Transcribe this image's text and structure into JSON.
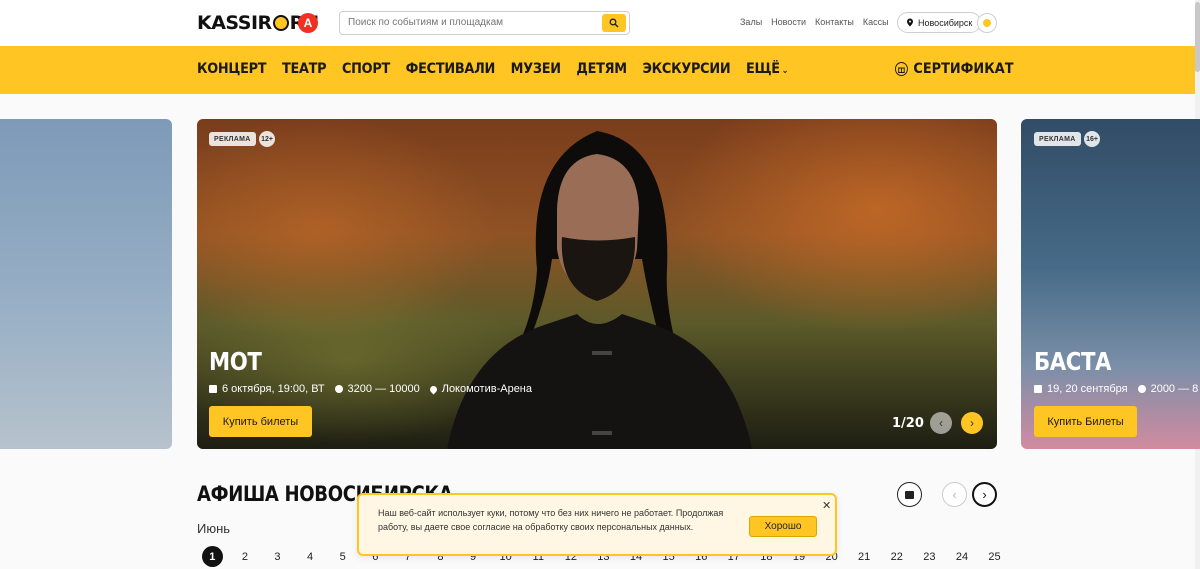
{
  "header": {
    "logo_text": "KASSIR",
    "logo_suffix": "RU",
    "partner_logo": "А",
    "search_placeholder": "Поиск по событиям и площадкам",
    "links": [
      "Залы",
      "Новости",
      "Контакты",
      "Кассы"
    ],
    "city": "Новосибирск"
  },
  "nav": {
    "items": [
      "КОНЦЕРТ",
      "ТЕАТР",
      "СПОРТ",
      "ФЕСТИВАЛИ",
      "МУЗЕИ",
      "ДЕТЯМ",
      "ЭКСКУРСИИ",
      "ЕЩЁ"
    ],
    "certificate": "СЕРТИФИКАТ"
  },
  "carousel": {
    "main": {
      "badge": "РЕКЛАМА",
      "age": "12+",
      "title": "МОТ",
      "date": "6 октября, 19:00, ВТ",
      "price": "3200 — 10000",
      "venue": "Локомотив-Арена",
      "buy_label": "Купить билеты"
    },
    "next": {
      "badge": "РЕКЛАМА",
      "age": "16+",
      "title": "БАСТА",
      "date": "19, 20 сентября",
      "price": "2000 — 8",
      "buy_label": "Купить Билеты"
    },
    "counter": "1/20"
  },
  "afisha": {
    "title": "АФИША НОВОСИБИРСКА",
    "month": "Июнь",
    "days": [
      "1",
      "2",
      "3",
      "4",
      "5",
      "6",
      "7",
      "8",
      "9",
      "10",
      "11",
      "12",
      "13",
      "14",
      "15",
      "16",
      "17",
      "18",
      "19",
      "20",
      "21",
      "22",
      "23",
      "24",
      "25"
    ],
    "active_day": "1"
  },
  "cookie": {
    "text": "Наш веб-сайт использует куки, потому что без них ничего не работает. Продолжая работу, вы даете свое согласие на обработку своих персональных данных.",
    "ok_label": "Хорошо"
  },
  "colors": {
    "accent": "#ffc522",
    "alfa": "#ef3124"
  }
}
